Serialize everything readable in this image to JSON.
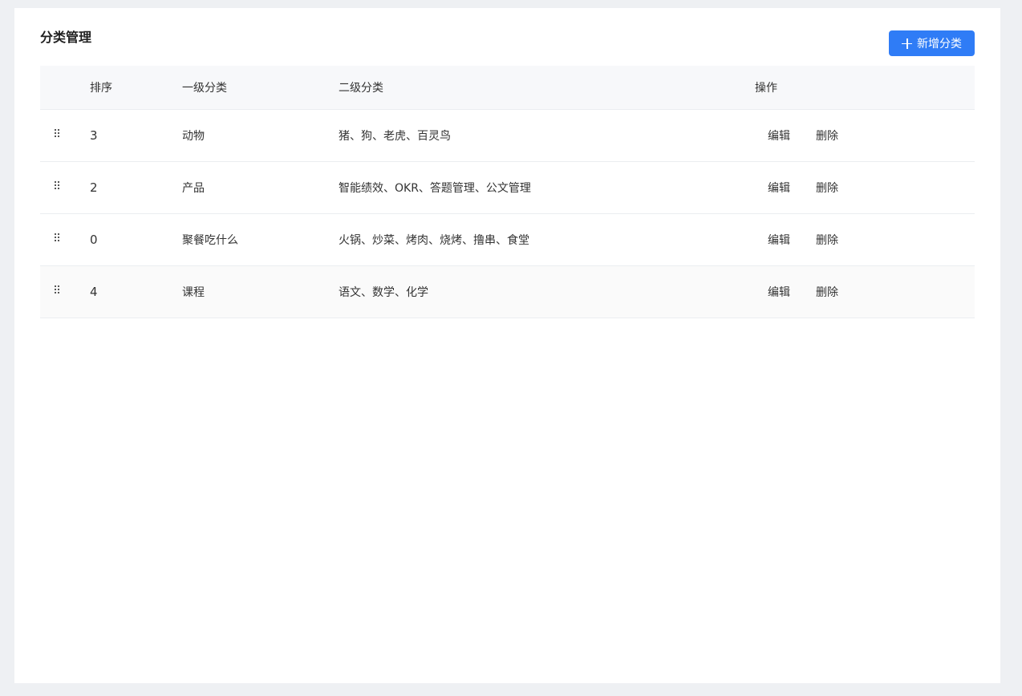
{
  "page": {
    "title": "分类管理"
  },
  "toolbar": {
    "add_label": "新增分类",
    "accent": "#2f7cf6"
  },
  "table": {
    "headers": {
      "sort": "排序",
      "level1": "一级分类",
      "level2": "二级分类",
      "ops": "操作"
    },
    "rows": [
      {
        "sort": "3",
        "level1": "动物",
        "level2": "猪、狗、老虎、百灵鸟",
        "edit": "编辑",
        "delete": "删除"
      },
      {
        "sort": "2",
        "level1": "产品",
        "level2": "智能绩效、OKR、答题管理、公文管理",
        "edit": "编辑",
        "delete": "删除"
      },
      {
        "sort": "0",
        "level1": "聚餐吃什么",
        "level2": "火锅、炒菜、烤肉、烧烤、撸串、食堂",
        "edit": "编辑",
        "delete": "删除"
      },
      {
        "sort": "4",
        "level1": "课程",
        "level2": "语文、数学、化学",
        "edit": "编辑",
        "delete": "删除"
      }
    ]
  }
}
